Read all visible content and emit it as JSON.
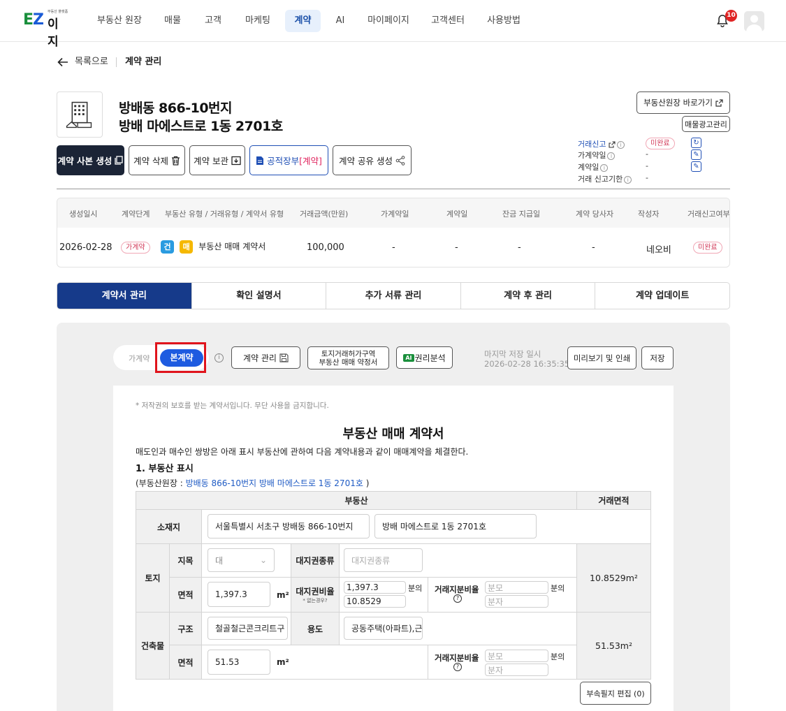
{
  "header": {
    "logo_main": "EZ",
    "logo_sub": "이지",
    "logo_tag": "부동산 플랫폼",
    "nav": [
      "부동산 원장",
      "매물",
      "고객",
      "마케팅",
      "계약",
      "AI",
      "마이페이지",
      "고객센터",
      "사용방법"
    ],
    "active_nav": "계약",
    "notification_count": "10"
  },
  "breadcrumb": {
    "back": "목록으로",
    "current": "계약 관리"
  },
  "property": {
    "title_line1": "방배동 866-10번지",
    "title_line2": "방배 마에스트로 1동 2701호"
  },
  "actions": {
    "create_copy": "계약 사본 생성",
    "delete": "계약 삭제",
    "archive": "계약 보관",
    "public_ledger": "공적장부",
    "public_ledger_tag": "[계약]",
    "share": "계약 공유 생성",
    "go_ledger": "부동산원장 바로가기",
    "ad_manage": "매물광고관리"
  },
  "status_panel": {
    "rows": [
      {
        "label": "거래신고",
        "value": "미완료"
      },
      {
        "label": "가계약일",
        "value": "-"
      },
      {
        "label": "계약일",
        "value": "-"
      },
      {
        "label": "거래 신고기한",
        "value": "-"
      }
    ]
  },
  "summary": {
    "headers": [
      "생성일시",
      "계약단계",
      "부동산 유형 / 거래유형 / 계약서 유형",
      "거래금액(만원)",
      "가계약일",
      "계약일",
      "잔금 지급일",
      "계약 당사자",
      "작성자",
      "거래신고여부"
    ],
    "created": "2026-02-28",
    "stage": "가계약",
    "type_tag1": "건",
    "type_tag2": "매",
    "contract_type": "부동산 매매 계약서",
    "amount": "100,000",
    "prov_date": "-",
    "contract_date": "-",
    "balance_date": "-",
    "parties": "-",
    "author": "네오비",
    "report_status": "미완료"
  },
  "tabs": [
    "계약서 관리",
    "확인 설명서",
    "추가 서류 관리",
    "계약 후 관리",
    "계약 업데이트"
  ],
  "toolbar": {
    "toggle_off": "가계약",
    "toggle_on": "본계약",
    "manage": "계약 관리",
    "land_permit_1": "토지거래허가구역",
    "land_permit_2": "부동산 매매 약정서",
    "ai_badge": "AI",
    "rights": "권리분석",
    "last_saved_label": "마지막 저장 일시",
    "last_saved": "2026-02-28 16:35:35",
    "preview": "미리보기 및 인쇄",
    "save": "저장"
  },
  "document": {
    "note": "* 저작권의 보호를 받는 계약서입니다. 무단 사용을 금지합니다.",
    "title": "부동산 매매 계약서",
    "intro": "매도인과 매수인 쌍방은 아래 표시 부동산에 관하여 다음 계약내용과 같이 매매계약을 체결한다.",
    "section1": "1. 부동산 표시",
    "ledger_prefix": "(부동산원장 : ",
    "ledger_link": "방배동 866-10번지 방배 마에스트로 1동 2701호",
    "ledger_suffix": " )",
    "table": {
      "h_property": "부동산",
      "h_area": "거래면적",
      "location": "소재지",
      "addr1": "서울특별시 서초구 방배동 866-10번지",
      "addr2": "방배 마에스트로 1동 2701호",
      "land": "토지",
      "jimok": "지목",
      "jimok_val": "대",
      "right_type": "대지권종류",
      "right_type_ph": "대지권종류",
      "area": "면적",
      "land_area": "1,397.3",
      "unit_m2": "m²",
      "right_ratio": "대지권비율",
      "right_ratio_note": "* 없는경우?",
      "ratio_a": "1,397.3",
      "ratio_b": "10.8529",
      "bun_ui": "분의",
      "trade_ratio": "거래지분비율",
      "ph_den": "분모",
      "ph_num": "분자",
      "land_trade_area": "10.8529m²",
      "building": "건축물",
      "structure": "구조",
      "structure_val": "철골철근콘크리트구",
      "use": "용도",
      "use_val": "공동주택(아파트),근",
      "bldg_area": "51.53",
      "bldg_trade_area": "51.53m²",
      "attached_edit": "부속필지 편집 (0)"
    }
  }
}
